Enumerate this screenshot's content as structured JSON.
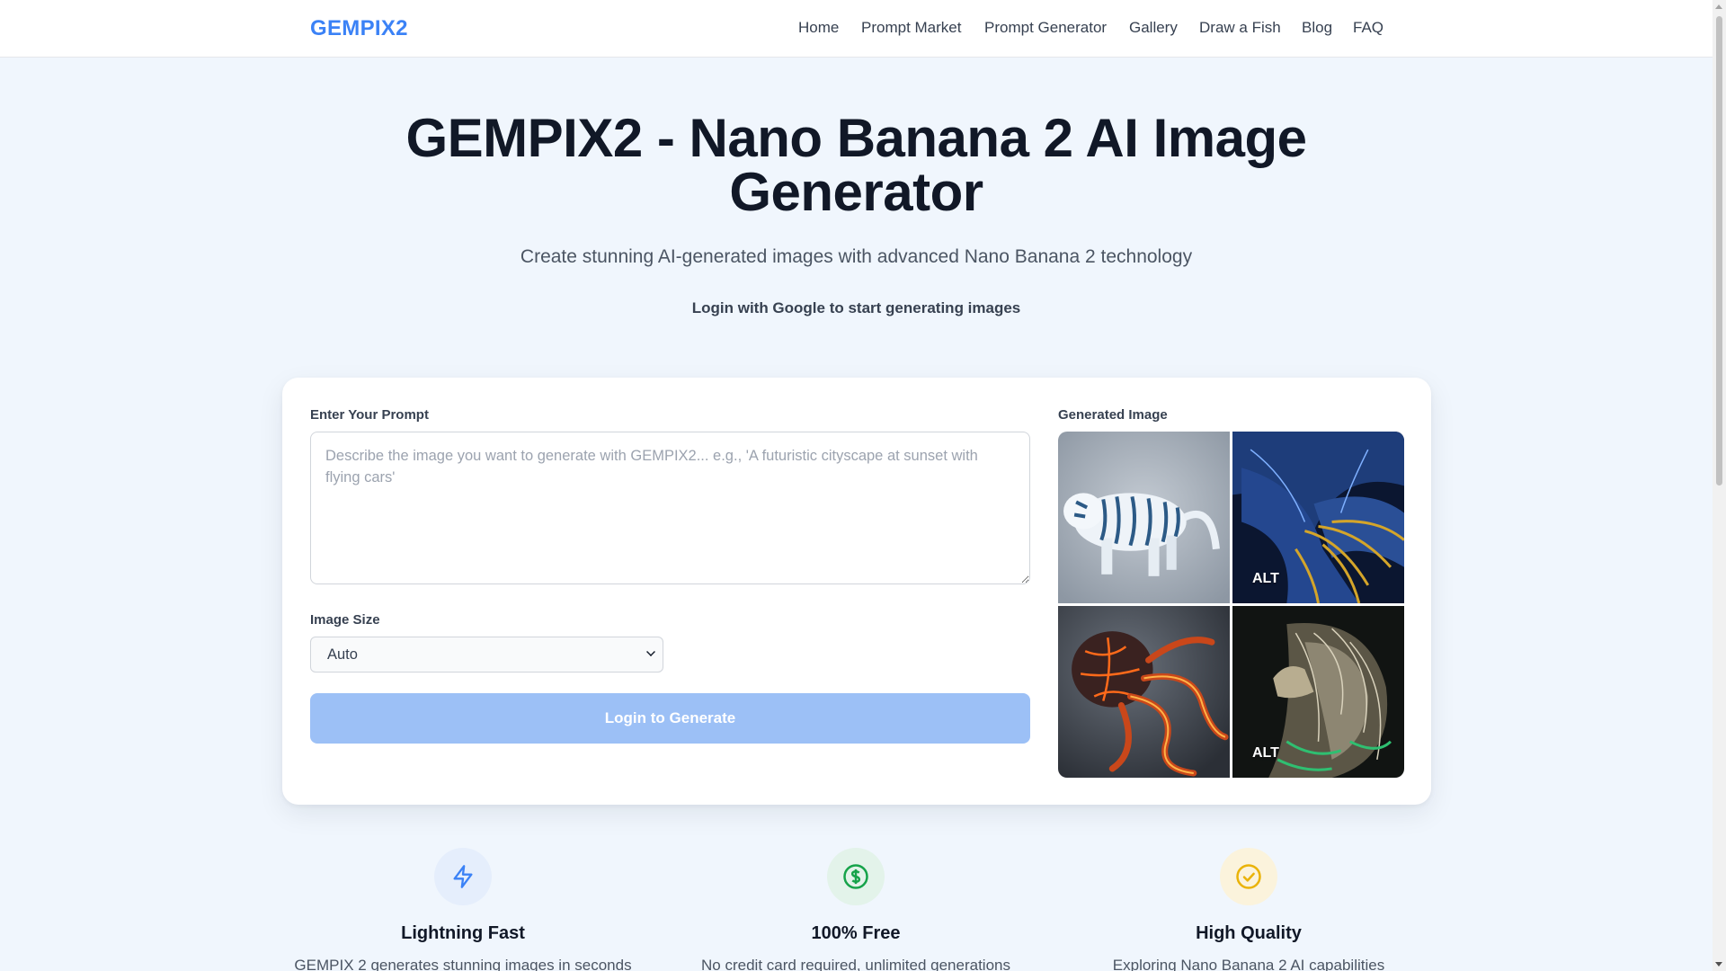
{
  "nav": {
    "logo": "GEMPIX2",
    "links": [
      "Home",
      "Prompt Market",
      "Prompt Generator",
      "Gallery",
      "Draw a Fish",
      "Blog",
      "FAQ"
    ]
  },
  "hero": {
    "title_line1": "GEMPIX2 - Nano Banana 2 AI Image",
    "title_line2": "Generator",
    "subtitle": "Create stunning AI-generated images with advanced Nano Banana 2 technology",
    "login_hint": "Login with Google to start generating images"
  },
  "form": {
    "prompt_label": "Enter Your Prompt",
    "prompt_value": "",
    "prompt_placeholder": "Describe the image you want to generate with GEMPIX2... e.g., 'A futuristic cityscape at sunset with flying cars'",
    "size_label": "Image Size",
    "size_selected": "Auto",
    "generate_label": "Login to Generate"
  },
  "gallery": {
    "label": "Generated Image",
    "images": [
      {
        "subject": "white tiger",
        "badge": ""
      },
      {
        "subject": "blue and gold phoenix",
        "badge": "ALT"
      },
      {
        "subject": "lava octopus",
        "badge": ""
      },
      {
        "subject": "glowing lion",
        "badge": "ALT"
      }
    ]
  },
  "features": [
    {
      "icon": "lightning-icon",
      "title": "Lightning Fast",
      "desc": "GEMPIX 2 generates stunning images in seconds",
      "color": "#3b82f6",
      "bg": "#e5eefc"
    },
    {
      "icon": "dollar-icon",
      "title": "100% Free",
      "desc": "No credit card required, unlimited generations",
      "color": "#16a34a",
      "bg": "#e3f3ea"
    },
    {
      "icon": "check-circle-icon",
      "title": "High Quality",
      "desc": "Exploring Nano Banana 2 AI capabilities",
      "color": "#eab308",
      "bg": "#fbf3dc"
    }
  ],
  "colors": {
    "brand": "#3b82f6",
    "button_disabled": "#9cc0f6",
    "page_bg": "#f0f6fd"
  }
}
